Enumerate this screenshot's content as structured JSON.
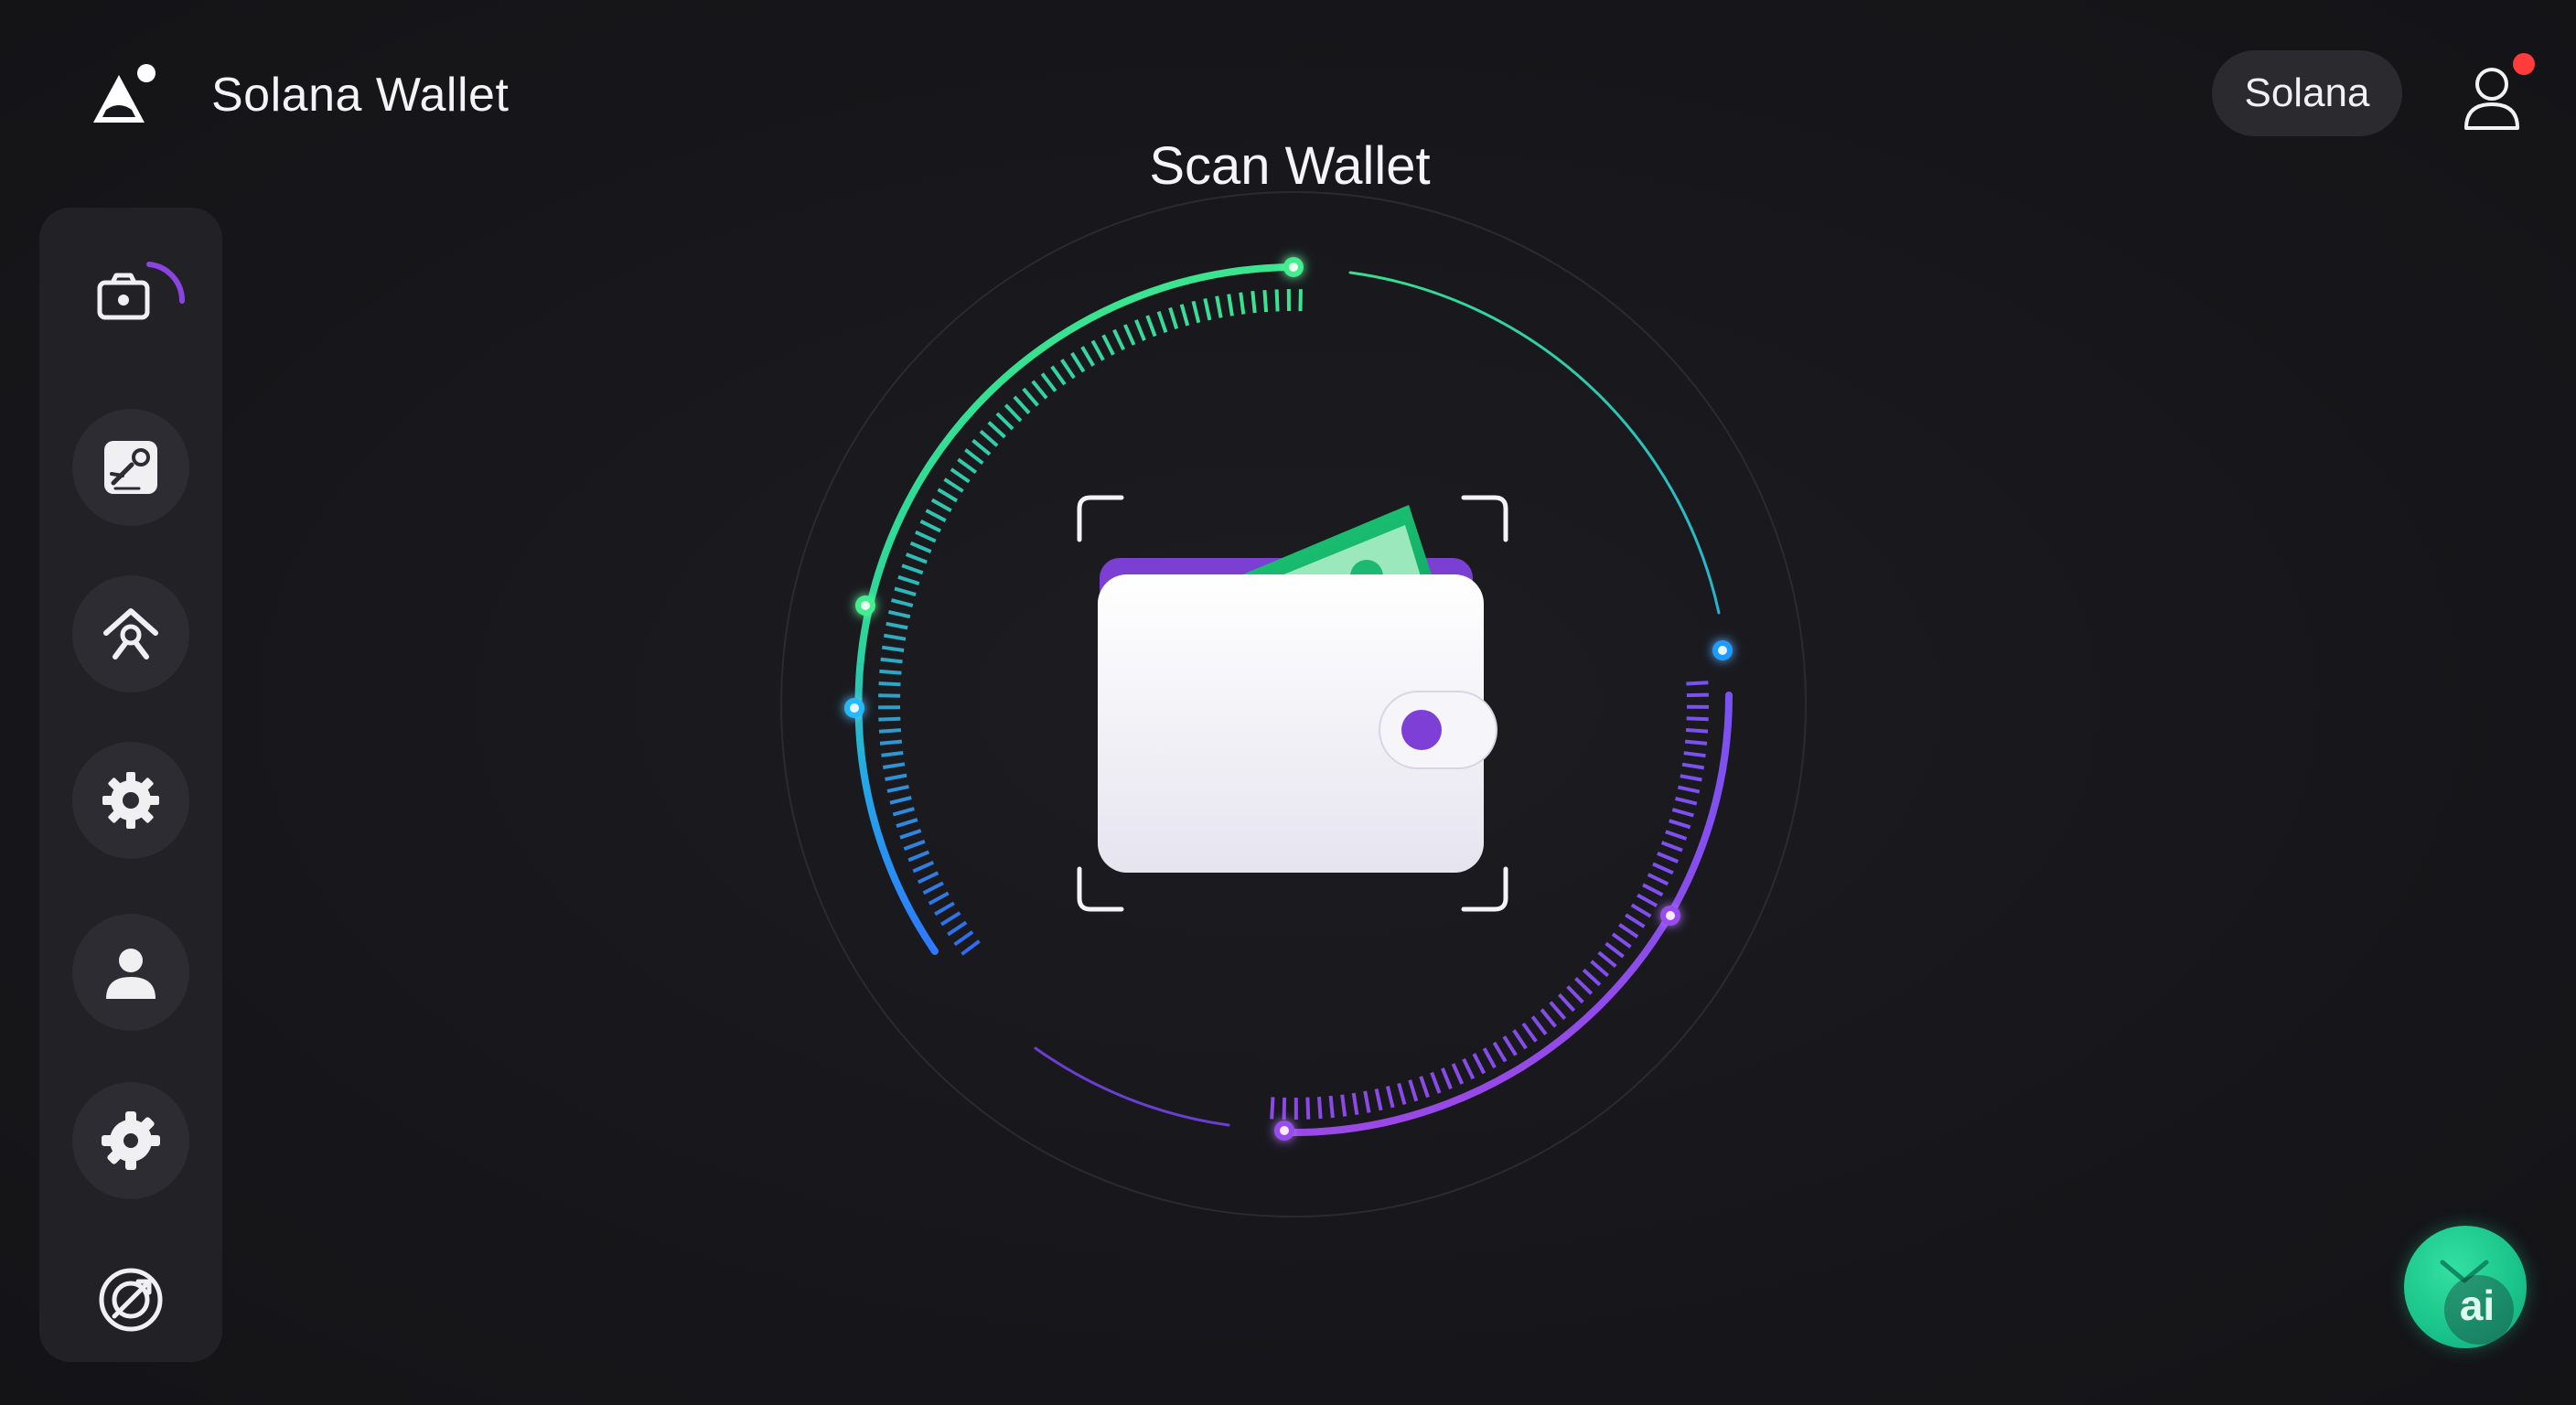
{
  "header": {
    "app_title": "Solana Wallet",
    "logo_icon": "solana-wallet-logo-icon",
    "network_label": "Solana",
    "profile_icon": "user-outline-icon",
    "notification_color": "#ff3b3b"
  },
  "sidebar": {
    "items": [
      {
        "name": "scan",
        "icon": "camera-icon",
        "active": true
      },
      {
        "name": "sign",
        "icon": "sign-document-icon",
        "active": false
      },
      {
        "name": "tools",
        "icon": "tools-icon",
        "active": false
      },
      {
        "name": "settings",
        "icon": "gear-icon",
        "active": false
      },
      {
        "name": "profile",
        "icon": "person-icon",
        "active": false
      },
      {
        "name": "preferences",
        "icon": "gear-badge-icon",
        "active": false
      },
      {
        "name": "sync",
        "icon": "sync-circle-icon",
        "active": false
      }
    ]
  },
  "scanner": {
    "title": "Scan Wallet",
    "center_icon": "wallet-with-cash-icon",
    "colors": {
      "green": "#2fe08a",
      "blue": "#2f8cff",
      "purple": "#8a4cf0",
      "accent": "#7d3fd6"
    }
  },
  "ai_button": {
    "label": "ai",
    "icon": "ai-assistant-icon",
    "color": "#1fc98f"
  }
}
